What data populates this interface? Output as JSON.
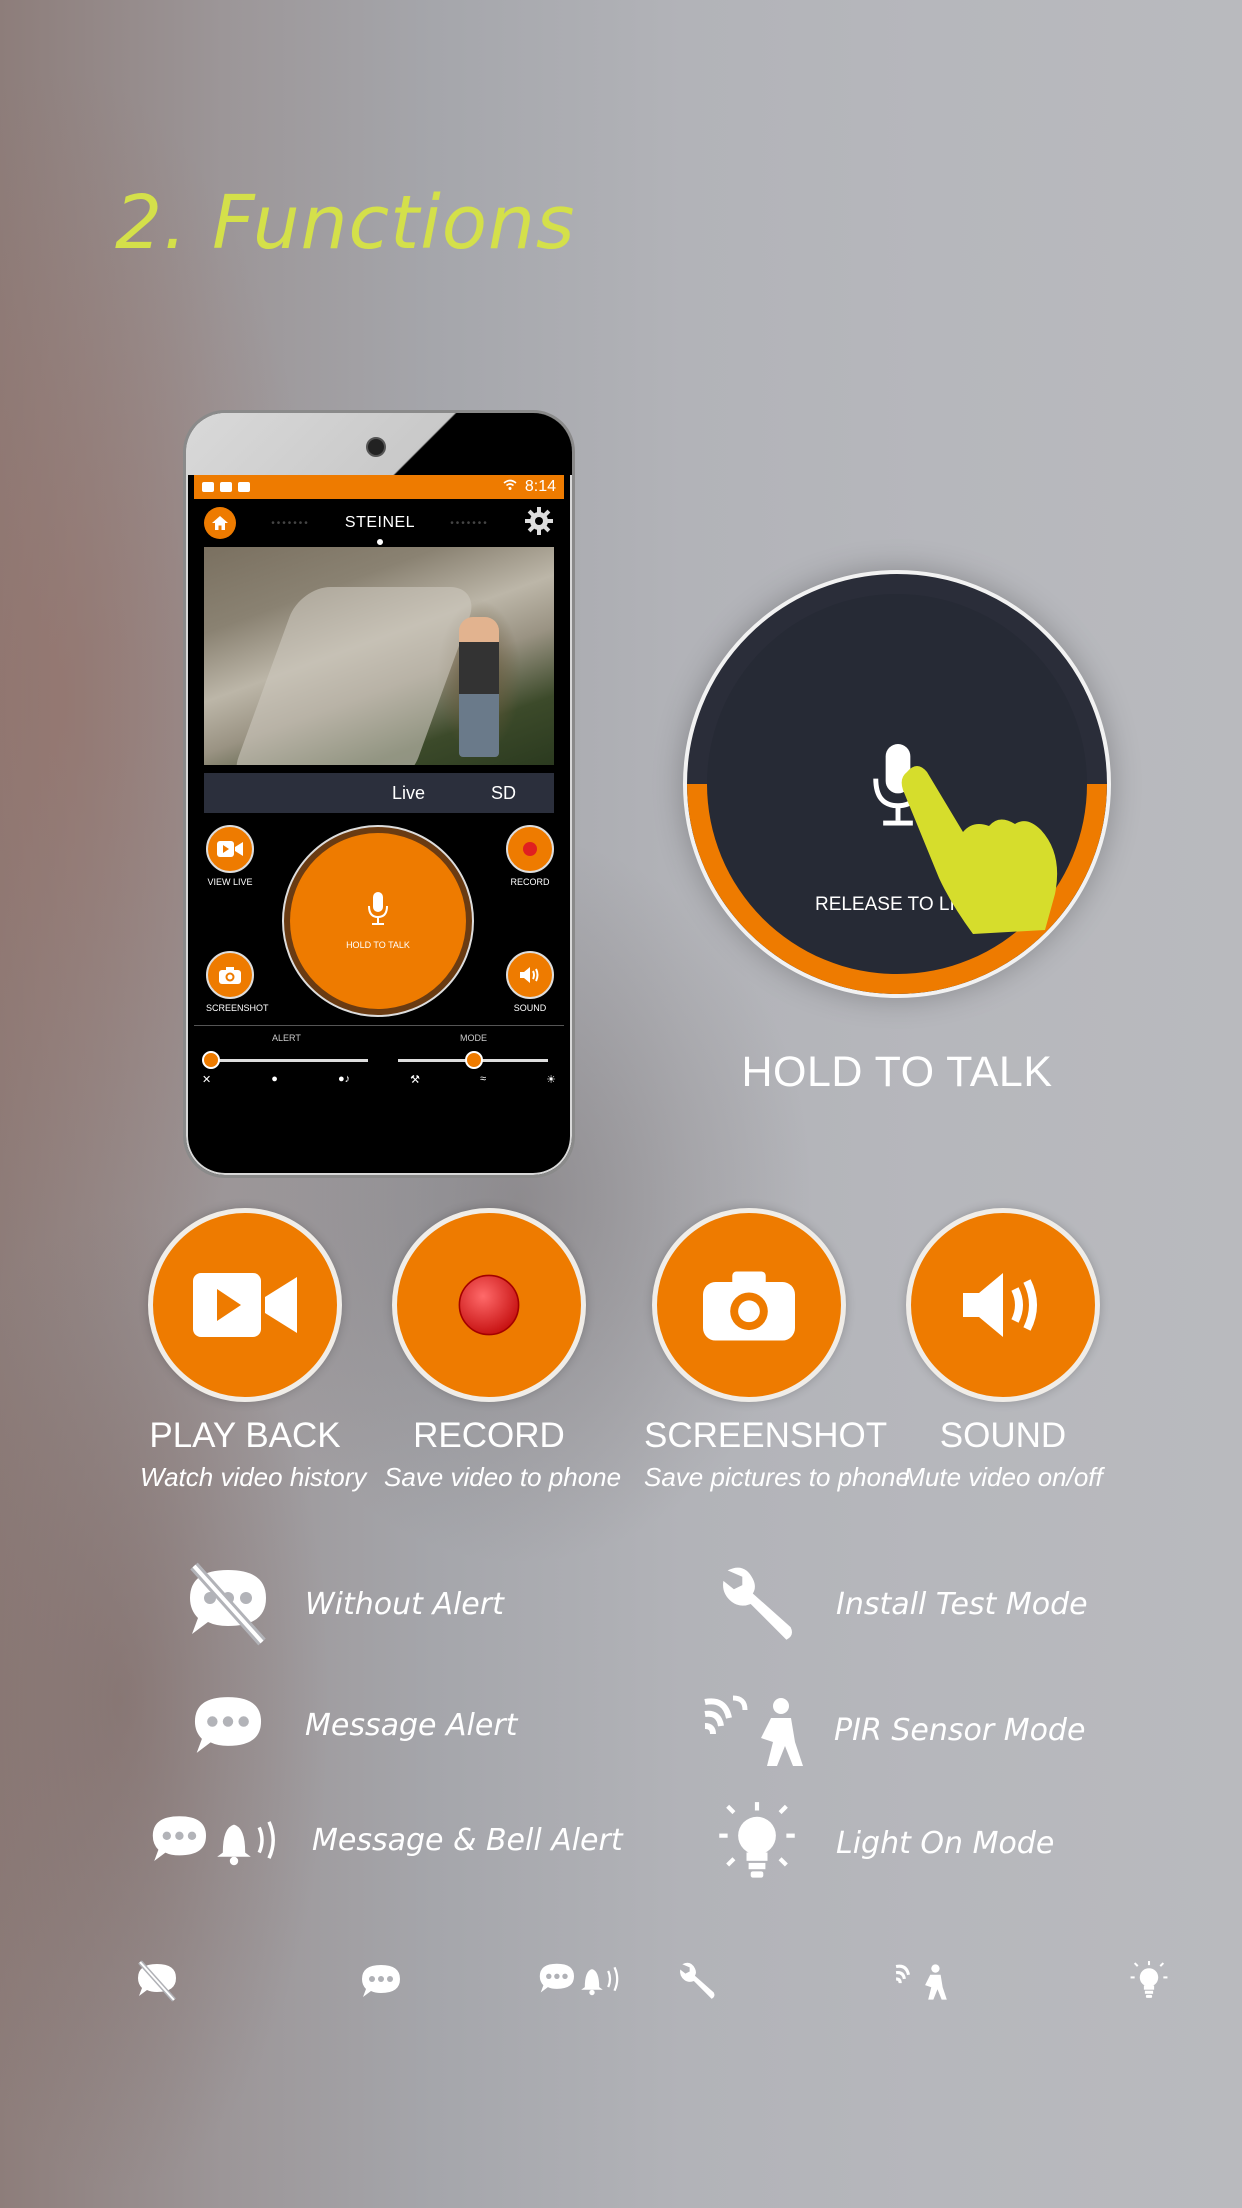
{
  "page": {
    "title": "2. Functions"
  },
  "phone": {
    "status_time": "8:14",
    "app_name": "STEINEL",
    "tabs": [
      "Live",
      "SD"
    ],
    "buttons": {
      "view_live": "VIEW LIVE",
      "record": "RECORD",
      "screenshot": "SCREENSHOT",
      "sound": "SOUND",
      "hold_to_talk": "HOLD TO TALK"
    },
    "slider_labels": {
      "alert": "ALERT",
      "mode": "MODE"
    }
  },
  "talk_zoom": {
    "release_label": "RELEASE TO LIST",
    "caption": "HOLD TO TALK"
  },
  "features": [
    {
      "name": "PLAY BACK",
      "desc": "Watch video history",
      "icon": "video-camera-icon"
    },
    {
      "name": "RECORD",
      "desc": "Save video to phone",
      "icon": "record-icon"
    },
    {
      "name": "SCREENSHOT",
      "desc": "Save pictures to phone",
      "icon": "camera-icon"
    },
    {
      "name": "SOUND",
      "desc": "Mute video on/off",
      "icon": "speaker-icon"
    }
  ],
  "legend": {
    "alerts": [
      {
        "label": "Without Alert",
        "icon": "no-alert-icon"
      },
      {
        "label": "Message Alert",
        "icon": "message-icon"
      },
      {
        "label": "Message & Bell Alert",
        "icon": "message-bell-icon"
      }
    ],
    "modes": [
      {
        "label": "Install Test Mode",
        "icon": "wrench-icon"
      },
      {
        "label": "PIR Sensor Mode",
        "icon": "pir-sensor-icon"
      },
      {
        "label": "Light On Mode",
        "icon": "light-bulb-icon"
      }
    ]
  },
  "colors": {
    "accent": "#ee7b00",
    "title": "#d4e04a",
    "dark": "#2a2d39",
    "finger": "#d6dd2c"
  }
}
